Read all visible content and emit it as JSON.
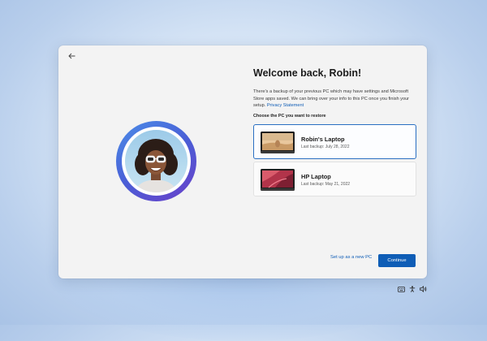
{
  "dialog": {
    "heading": "Welcome back, Robin!",
    "description": "There's a backup of your previous PC which may have settings and Microsoft Store apps saved. We can bring over your info to this PC once you finish your setup.",
    "privacy_link": "Privacy Statement",
    "choose_label": "Choose the PC you want to restore",
    "pcs": [
      {
        "name": "Robin's Laptop",
        "last_backup": "Last backup: July 28, 2022",
        "selected": true,
        "thumb": "desert-photo"
      },
      {
        "name": "HP Laptop",
        "last_backup": "Last backup: May 21, 2022",
        "selected": false,
        "thumb": "red-abstract"
      }
    ],
    "secondary_action": "Set up as a new PC",
    "primary_action": "Continue"
  },
  "tray_icons": [
    "keyboard-icon",
    "accessibility-icon",
    "volume-icon"
  ],
  "colors": {
    "accent": "#0f5db6",
    "ring_start": "#4b8ee8",
    "ring_end": "#6a3fc9"
  }
}
